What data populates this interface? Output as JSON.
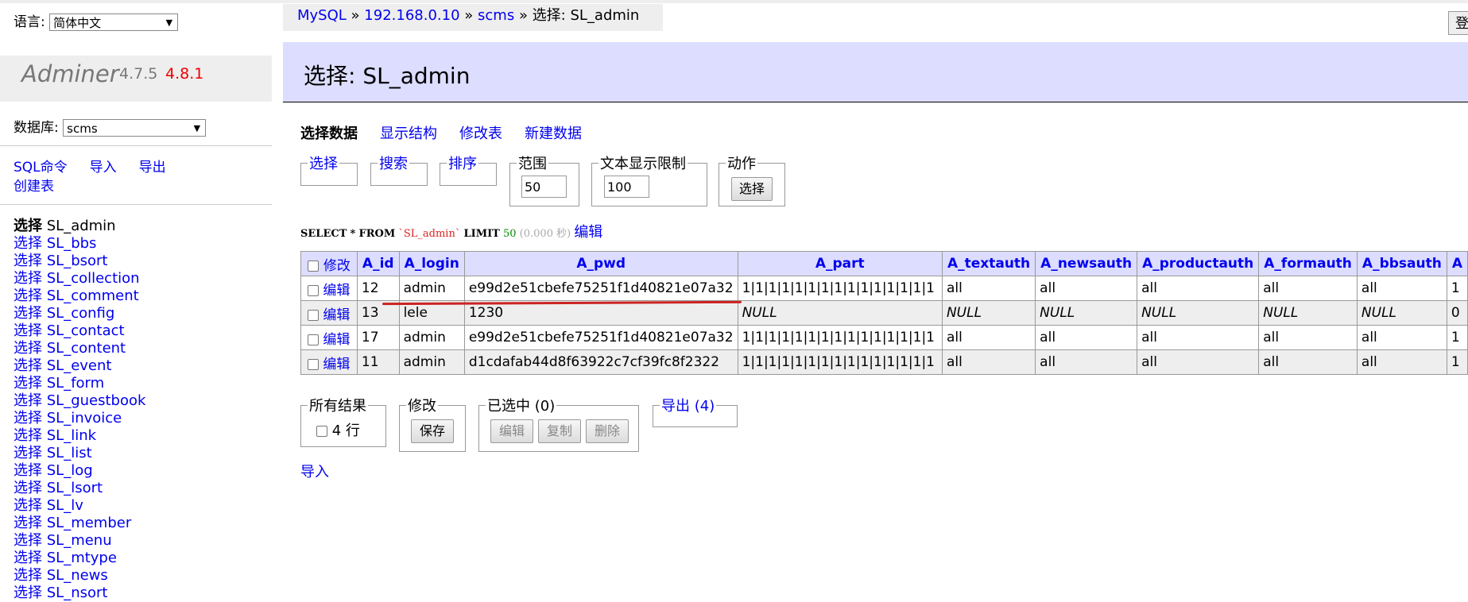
{
  "sidebar": {
    "lang_label": "语言:",
    "lang_value": "简体中文",
    "brand_name": "Adminer",
    "version": "4.7.5",
    "new_version": "4.8.1",
    "db_label": "数据库:",
    "db_value": "scms",
    "links": [
      "SQL命令",
      "导入",
      "导出",
      "创建表"
    ],
    "tables": [
      {
        "action": "选择",
        "name": "SL_admin"
      },
      {
        "action": "选择",
        "name": "SL_bbs"
      },
      {
        "action": "选择",
        "name": "SL_bsort"
      },
      {
        "action": "选择",
        "name": "SL_collection"
      },
      {
        "action": "选择",
        "name": "SL_comment"
      },
      {
        "action": "选择",
        "name": "SL_config"
      },
      {
        "action": "选择",
        "name": "SL_contact"
      },
      {
        "action": "选择",
        "name": "SL_content"
      },
      {
        "action": "选择",
        "name": "SL_event"
      },
      {
        "action": "选择",
        "name": "SL_form"
      },
      {
        "action": "选择",
        "name": "SL_guestbook"
      },
      {
        "action": "选择",
        "name": "SL_invoice"
      },
      {
        "action": "选择",
        "name": "SL_link"
      },
      {
        "action": "选择",
        "name": "SL_list"
      },
      {
        "action": "选择",
        "name": "SL_log"
      },
      {
        "action": "选择",
        "name": "SL_lsort"
      },
      {
        "action": "选择",
        "name": "SL_lv"
      },
      {
        "action": "选择",
        "name": "SL_member"
      },
      {
        "action": "选择",
        "name": "SL_menu"
      },
      {
        "action": "选择",
        "name": "SL_mtype"
      },
      {
        "action": "选择",
        "name": "SL_news"
      },
      {
        "action": "选择",
        "name": "SL_nsort"
      }
    ]
  },
  "breadcrumb": {
    "mysql": "MySQL",
    "sep": "»",
    "host": "192.168.0.10",
    "db": "scms",
    "current": "选择: SL_admin"
  },
  "login_button": "登",
  "page_title": "选择: SL_admin",
  "tabs": [
    "选择数据",
    "显示结构",
    "修改表",
    "新建数据"
  ],
  "filters": {
    "select": "选择",
    "search": "搜索",
    "sort": "排序",
    "limit_label": "范围",
    "limit_value": "50",
    "text_limit_label": "文本显示限制",
    "text_limit_value": "100",
    "action_label": "动作",
    "action_button": "选择"
  },
  "query": {
    "select": "SELECT",
    "star": "*",
    "from": "FROM",
    "table": "`SL_admin`",
    "limit": "LIMIT",
    "limit_n": "50",
    "time": "(0.000 秒)",
    "edit": "编辑"
  },
  "grid": {
    "edit_header": "修改",
    "columns": [
      "A_id",
      "A_login",
      "A_pwd",
      "A_part",
      "A_textauth",
      "A_newsauth",
      "A_productauth",
      "A_formauth",
      "A_bbsauth",
      "A"
    ],
    "row_edit": "编辑",
    "rows": [
      [
        "12",
        "admin",
        "e99d2e51cbefe75251f1d40821e07a32",
        "1|1|1|1|1|1|1|1|1|1|1|1|1|1|1",
        "all",
        "all",
        "all",
        "all",
        "all",
        "1"
      ],
      [
        "13",
        "lele",
        "1230",
        "NULL",
        "NULL",
        "NULL",
        "NULL",
        "NULL",
        "NULL",
        "0"
      ],
      [
        "17",
        "admin",
        "e99d2e51cbefe75251f1d40821e07a32",
        "1|1|1|1|1|1|1|1|1|1|1|1|1|1|1",
        "all",
        "all",
        "all",
        "all",
        "all",
        "1"
      ],
      [
        "11",
        "admin",
        "d1cdafab44d8f63922c7cf39fc8f2322",
        "1|1|1|1|1|1|1|1|1|1|1|1|1|1|1",
        "all",
        "all",
        "all",
        "all",
        "all",
        "1"
      ]
    ]
  },
  "bottom": {
    "all_results_label": "所有结果",
    "rows_count": "4 行",
    "modify_label": "修改",
    "save_button": "保存",
    "selected_label": "已选中 (0)",
    "edit_button": "编辑",
    "clone_button": "复制",
    "delete_button": "删除",
    "export_link": "导出 (4)",
    "import_link": "导入"
  }
}
